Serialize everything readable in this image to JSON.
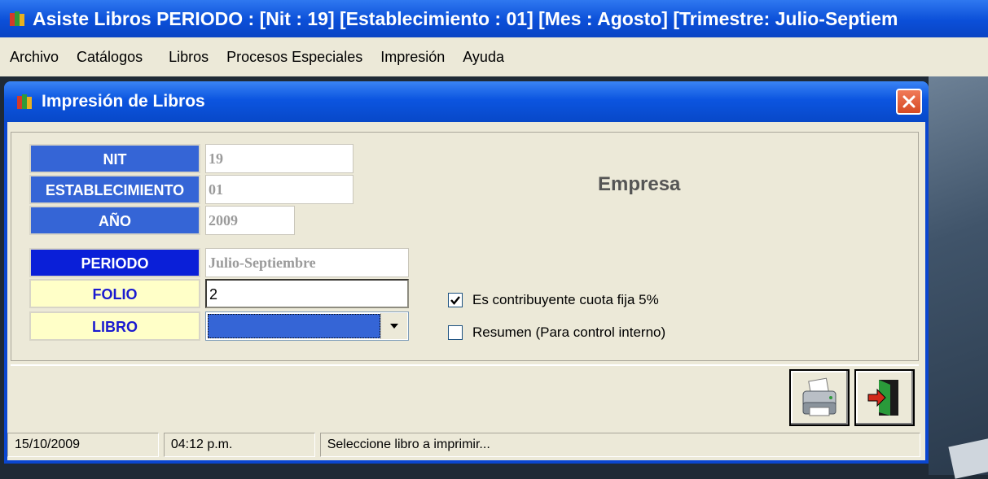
{
  "window": {
    "title": "Asiste Libros PERIODO : [Nit : 19] [Establecimiento : 01] [Mes : Agosto] [Trimestre: Julio-Septiem",
    "icon": "books-app-icon"
  },
  "menu": [
    "Archivo",
    "Catálogos",
    "Libros",
    "Procesos Especiales",
    "Impresión",
    "Ayuda"
  ],
  "dialog": {
    "title": "Impresión de Libros",
    "close_icon": "close-icon"
  },
  "form": {
    "nit_label": "NIT",
    "nit_value": "19",
    "estab_label": "ESTABLECIMIENTO",
    "estab_value": "01",
    "anio_label": "AÑO",
    "anio_value": "2009",
    "periodo_label": "PERIODO",
    "periodo_value": "Julio-Septiembre",
    "folio_label": "FOLIO",
    "folio_value": "2",
    "libro_label": "LIBRO",
    "libro_value": ""
  },
  "empresa_label": "Empresa",
  "options": {
    "cuota_fija": {
      "label": "Es contribuyente cuota fija 5%",
      "checked": true
    },
    "resumen": {
      "label": "Resumen (Para control interno)",
      "checked": false
    }
  },
  "buttons": {
    "print_icon": "printer-icon",
    "exit_icon": "exit-door-icon"
  },
  "status": {
    "date": "15/10/2009",
    "time": "04:12 p.m.",
    "message": "Seleccione libro a imprimir..."
  },
  "colors": {
    "title_blue": "#0b4fd8",
    "label_blue": "#3565d6",
    "label_navy": "#0a1fd8",
    "label_yellow": "#ffffc8",
    "panel_bg": "#ece9d8"
  }
}
